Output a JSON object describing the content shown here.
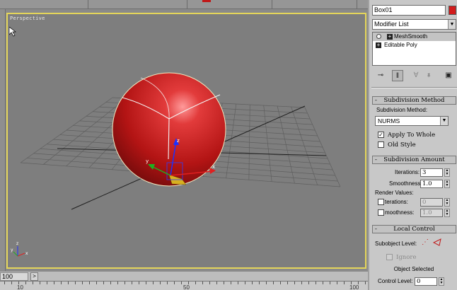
{
  "viewport": {
    "label": "Perspective"
  },
  "timeline": {
    "frame_value": "100",
    "next_arrow": ">",
    "ruler_numbers": [
      "10",
      "",
      "",
      "",
      "",
      "50",
      "",
      "",
      "",
      "",
      "100"
    ]
  },
  "command_panel": {
    "object_name": "Box01",
    "object_color": "#d21b1b",
    "modifier_list_label": "Modifier List",
    "stack": [
      {
        "label": "MeshSmooth",
        "selected": true
      },
      {
        "label": "Editable Poly",
        "selected": false
      }
    ],
    "subdivision_method": {
      "title": "Subdivision Method",
      "method_label": "Subdivision Method:",
      "method_value": "NURMS",
      "apply_to_whole": "Apply To Whole",
      "old_style": "Old Style"
    },
    "subdivision_amount": {
      "title": "Subdivision Amount",
      "iterations_label": "Iterations:",
      "iterations_value": "3",
      "smoothness_label": "Smoothness:",
      "smoothness_value": "1.0",
      "render_values_label": "Render Values:",
      "render_iterations_label": "terations:",
      "render_iterations_value": "0",
      "render_smoothness_label": "moothness:",
      "render_smoothness_value": "1.0"
    },
    "local_control": {
      "title": "Local Control",
      "subobject_label": "Subobject Level:",
      "ignore_label": "Ignore",
      "status": "Object Selected",
      "control_level_label": "Control Level:",
      "control_level_value": "0"
    },
    "rollout_sign": "-"
  }
}
